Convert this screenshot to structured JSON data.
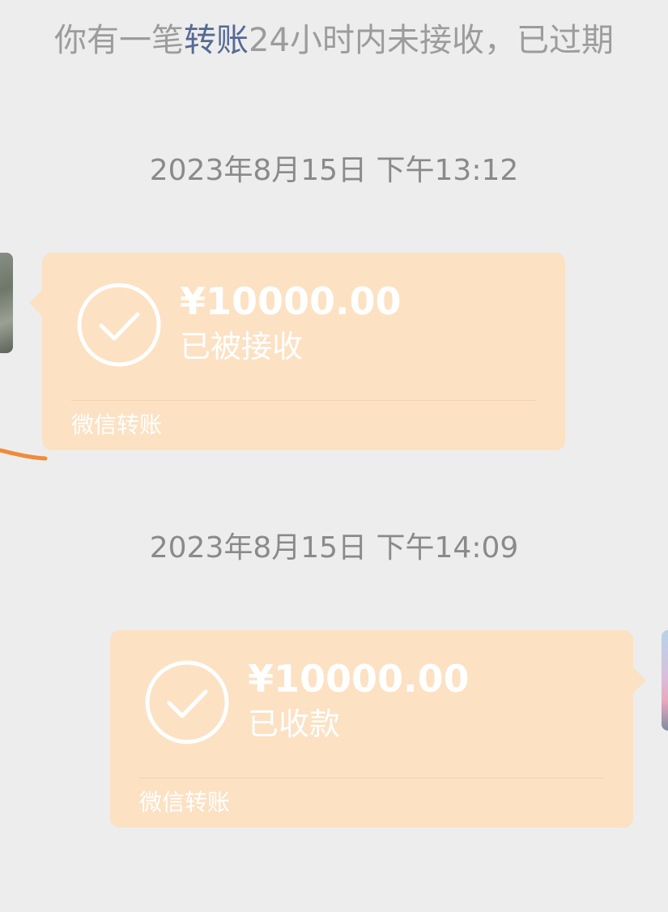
{
  "system_notice": {
    "prefix": "你有一笔",
    "link": "转账",
    "suffix": "24小时内未接收，已过期"
  },
  "messages": [
    {
      "timestamp": "2023年8月15日 下午13:12",
      "side": "left",
      "amount": "¥10000.00",
      "status": "已被接收",
      "footer": "微信转账"
    },
    {
      "timestamp": "2023年8月15日 下午14:09",
      "side": "right",
      "amount": "¥10000.00",
      "status": "已收款",
      "footer": "微信转账"
    }
  ],
  "icons": {
    "transfer_done": "check-circle-icon"
  },
  "colors": {
    "background": "#ededed",
    "bubble": "#fce1c3",
    "link": "#556a94",
    "notice_text": "#9c9c9c",
    "scribble": "#f08b3a"
  }
}
